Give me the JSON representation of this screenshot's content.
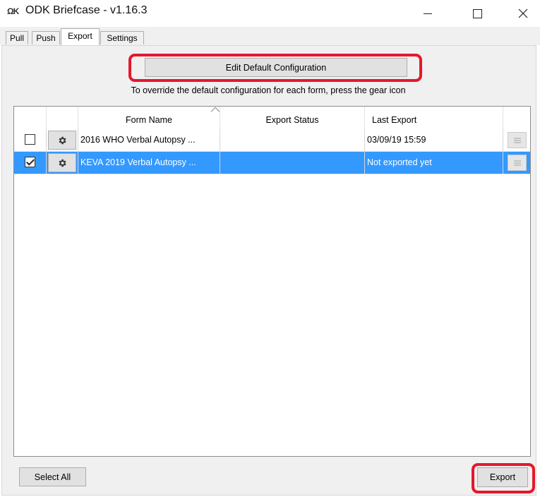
{
  "window": {
    "logo": "ΩK",
    "title": "ODK Briefcase - v1.16.3",
    "controls": [
      "minimize-icon",
      "maximize-icon",
      "close-icon"
    ]
  },
  "tabs": [
    {
      "label": "Pull",
      "active": false
    },
    {
      "label": "Push",
      "active": false
    },
    {
      "label": "Export",
      "active": true
    },
    {
      "label": "Settings",
      "active": false
    }
  ],
  "export": {
    "edit_default_label": "Edit Default Configuration",
    "hint": "To override the default configuration for each form, press the gear icon",
    "table": {
      "columns": [
        "",
        "",
        "Form Name",
        "Export Status",
        "Last Export",
        ""
      ],
      "sorted_column": "Form Name",
      "rows": [
        {
          "checked": false,
          "form_name": "2016 WHO Verbal Autopsy ...",
          "export_status": "",
          "last_export": "03/09/19 15:59",
          "selected": false
        },
        {
          "checked": true,
          "form_name": "KEVA 2019 Verbal Autopsy ...",
          "export_status": "",
          "last_export": "Not exported yet",
          "selected": true
        }
      ]
    },
    "select_all_label": "Select All",
    "export_label": "Export"
  },
  "colors": {
    "selection": "#3399ff",
    "highlight": "#e4182c",
    "panel": "#f0f0f0"
  },
  "icons": {
    "gear": "gear-icon",
    "detail": "list-detail-icon",
    "sort": "sort-ascending-icon"
  }
}
